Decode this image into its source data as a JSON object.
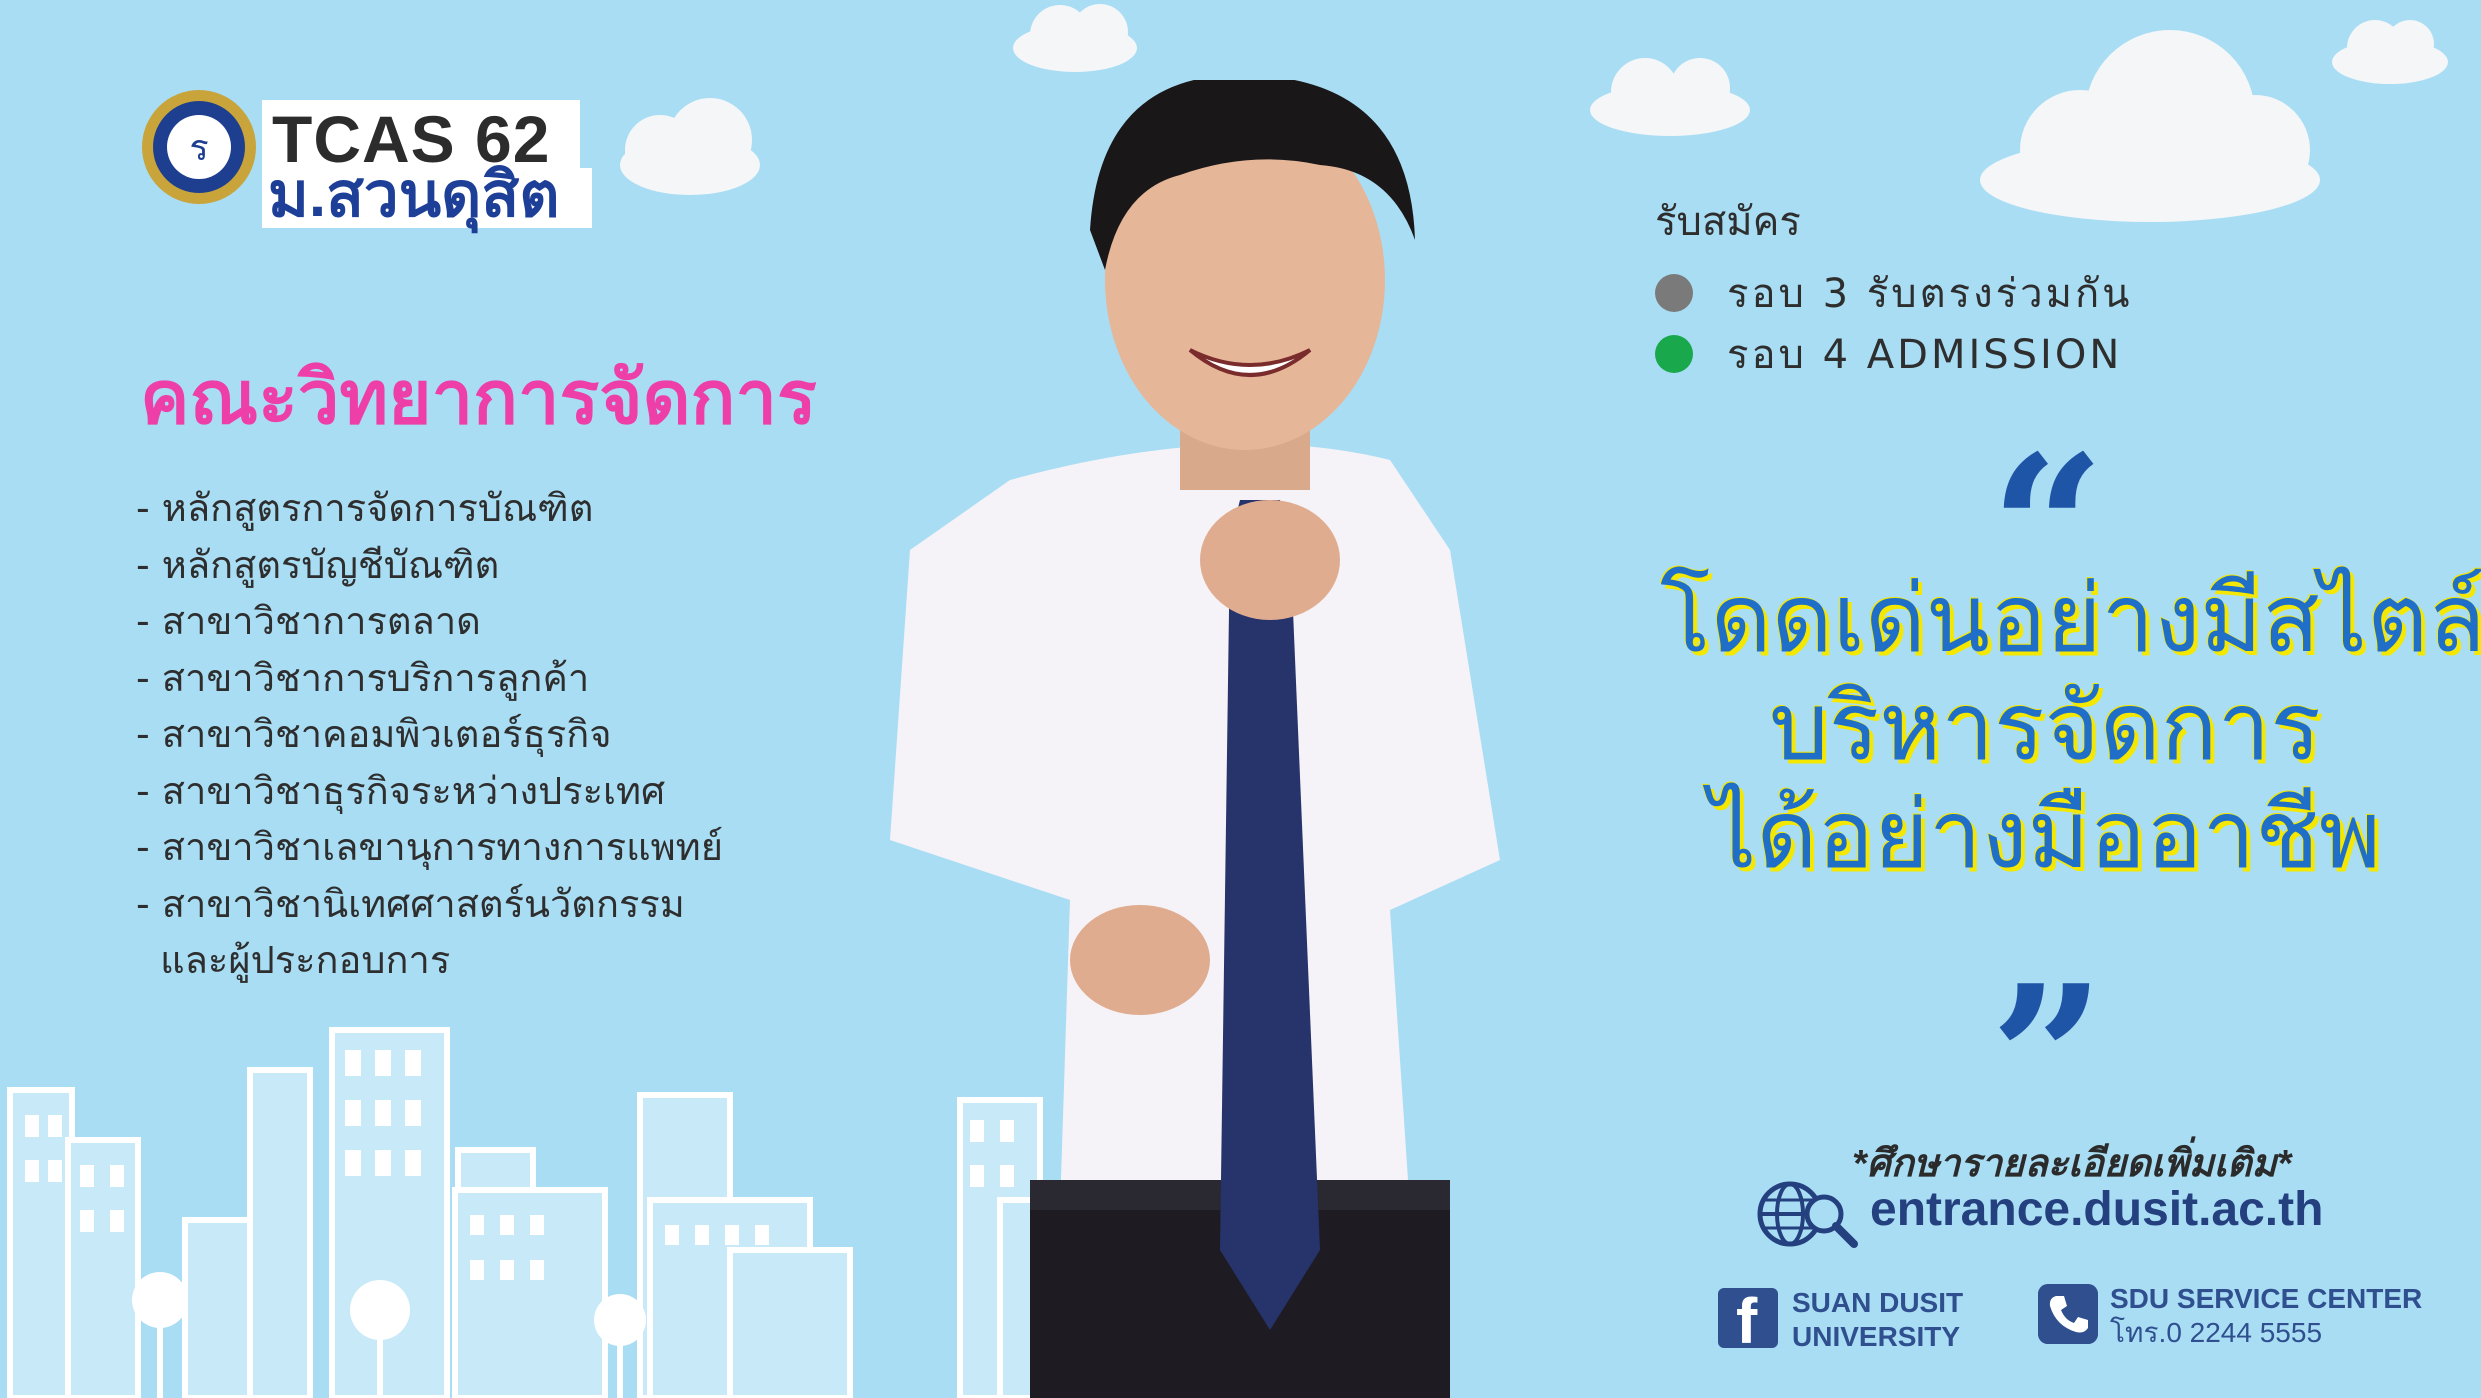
{
  "colors": {
    "background": "#a9ddf4",
    "faculty_title": "#ee3fa9",
    "quote_text": "#1f6fc9",
    "quote_outline": "#f4e700",
    "quote_marks": "#1f55a6",
    "round3_dot": "#7a7a7a",
    "round4_dot": "#19a84c",
    "contact_blue": "#2f4f8f"
  },
  "logo": {
    "tcas": "TCAS 62",
    "university": "ม.สวนดุสิต",
    "seal_icon": "suan-dusit-university-seal"
  },
  "faculty": {
    "title": "คณะวิทยาการจัดการ",
    "programs": [
      "- หลักสูตรการจัดการบัณฑิต",
      "- หลักสูตรบัญชีบัณฑิต",
      "- สาขาวิชาการตลาด",
      "- สาขาวิชาการบริการลูกค้า",
      "- สาขาวิชาคอมพิวเตอร์ธุรกิจ",
      "- สาขาวิชาธุรกิจระหว่างประเทศ",
      "- สาขาวิชาเลขานุการทางการแพทย์",
      "- สาขาวิชานิเทศศาสตร์นวัตกรรม",
      "  และผู้ประกอบการ"
    ]
  },
  "apply": {
    "label": "รับสมัคร",
    "rounds": [
      {
        "text": "รอบ 3 รับตรงร่วมกัน"
      },
      {
        "text": "รอบ 4 ADMISSION"
      }
    ]
  },
  "quote": {
    "open": "“",
    "lines": [
      "โดดเด่นอย่างมีสไตล์",
      "บริหารจัดการ",
      "ได้อย่างมืออาชีพ"
    ],
    "close": "”"
  },
  "contact": {
    "more_info": "*ศึกษารายละเอียดเพิ่มเติม*",
    "website": "entrance.dusit.ac.th",
    "facebook_line1": "SUAN DUSIT",
    "facebook_line2": "UNIVERSITY",
    "service_line1": "SDU SERVICE CENTER",
    "service_line2": "โทร.0 2244 5555",
    "icons": [
      "globe-search-icon",
      "facebook-icon",
      "phone-icon"
    ]
  }
}
